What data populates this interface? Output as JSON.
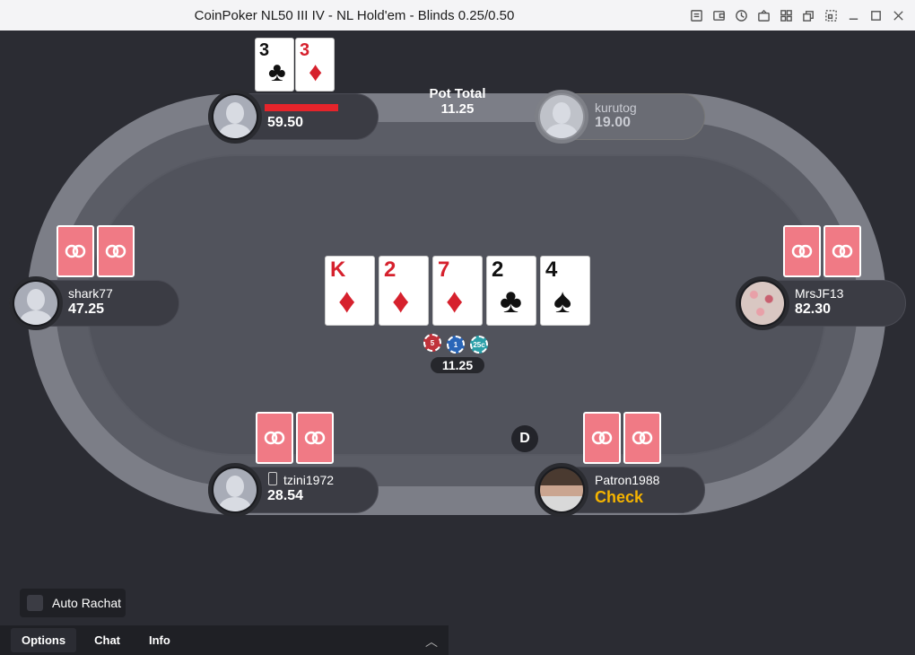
{
  "window": {
    "title": "CoinPoker NL50 III IV - NL Hold'em - Blinds 0.25/0.50"
  },
  "pot": {
    "label": "Pot Total",
    "amount": "11.25",
    "bet_amount": "11.25"
  },
  "board": [
    {
      "rank": "K",
      "suit": "♦",
      "color": "red"
    },
    {
      "rank": "2",
      "suit": "♦",
      "color": "red"
    },
    {
      "rank": "7",
      "suit": "♦",
      "color": "red"
    },
    {
      "rank": "2",
      "suit": "♣",
      "color": "black"
    },
    {
      "rank": "4",
      "suit": "♠",
      "color": "black"
    }
  ],
  "chips": [
    {
      "label": "5",
      "color": "#c0323b"
    },
    {
      "label": "1",
      "color": "#2a66b8"
    },
    {
      "label": "25c",
      "color": "#2b9fa8"
    }
  ],
  "players": {
    "top_left": {
      "name": "",
      "stack": "59.50",
      "cards": [
        {
          "rank": "3",
          "suit": "♣",
          "color": "black"
        },
        {
          "rank": "3",
          "suit": "♦",
          "color": "red"
        }
      ]
    },
    "top_right": {
      "name": "kurutog",
      "stack": "19.00"
    },
    "left": {
      "name": "shark77",
      "stack": "47.25"
    },
    "right": {
      "name": "MrsJF13",
      "stack": "82.30"
    },
    "bottom_left": {
      "name": "tzini1972",
      "stack": "28.54"
    },
    "bottom_right": {
      "name": "Patron1988",
      "action": "Check"
    }
  },
  "dealer_button": "D",
  "bottom": {
    "auto_rachat": "Auto Rachat",
    "tabs": [
      "Options",
      "Chat",
      "Info"
    ]
  },
  "colors": {
    "accent": "#f5b400",
    "card_back": "#f07a85",
    "timer": "#e5242b"
  }
}
